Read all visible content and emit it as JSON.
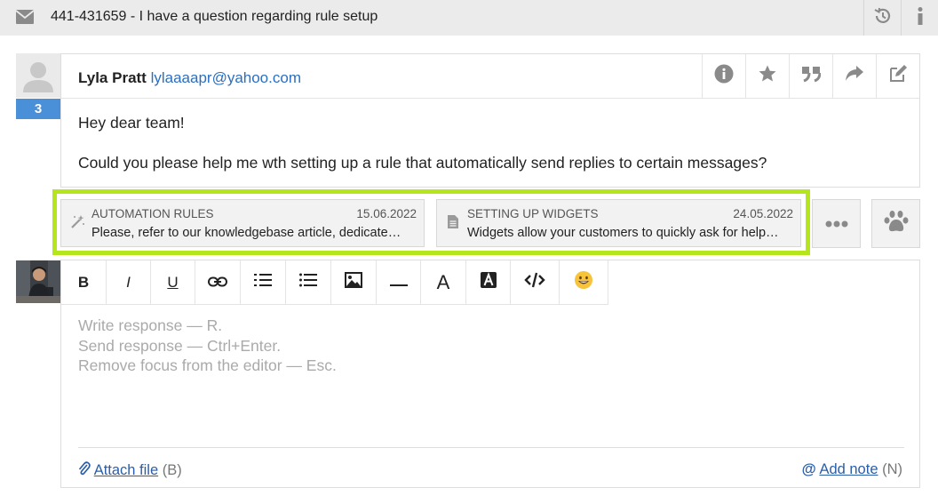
{
  "header": {
    "title": "441-431659 - I have a question regarding rule setup",
    "icons": [
      "envelope-icon",
      "history-icon",
      "info-icon"
    ]
  },
  "message": {
    "unread_count": "3",
    "author_name": "Lyla Pratt",
    "author_email": "lylaaaapr@yahoo.com",
    "actions": [
      "info-icon",
      "star-icon",
      "quote-icon",
      "forward-icon",
      "edit-icon"
    ],
    "body": [
      "Hey dear team!",
      "Could you please help me wth setting up a rule that automatically send replies to certain messages?"
    ]
  },
  "suggestions": [
    {
      "icon": "magic-wand-icon",
      "category": "AUTOMATION RULES",
      "date": "15.06.2022",
      "text": "Please, refer to our knowledgebase article, dedicate…"
    },
    {
      "icon": "document-icon",
      "category": "SETTING UP WIDGETS",
      "date": "24.05.2022",
      "text": "Widgets allow your customers to quickly ask for help…"
    }
  ],
  "suggestion_buttons": [
    "more-icon",
    "paw-icon"
  ],
  "highlight_color": "#b5e61d",
  "editor": {
    "toolbar": {
      "bold": "B",
      "italic": "I",
      "underline": "U",
      "text_color": "A"
    },
    "placeholder_lines": [
      "Write response — R.",
      "Send response — Ctrl+Enter.",
      "Remove focus from the editor — Esc."
    ],
    "attach_label": "Attach file",
    "attach_hint": "(B)",
    "note_label": "Add note",
    "note_hint": "(N)"
  },
  "colors": {
    "accent": "#4a90d9",
    "link": "#2a6fc2"
  }
}
